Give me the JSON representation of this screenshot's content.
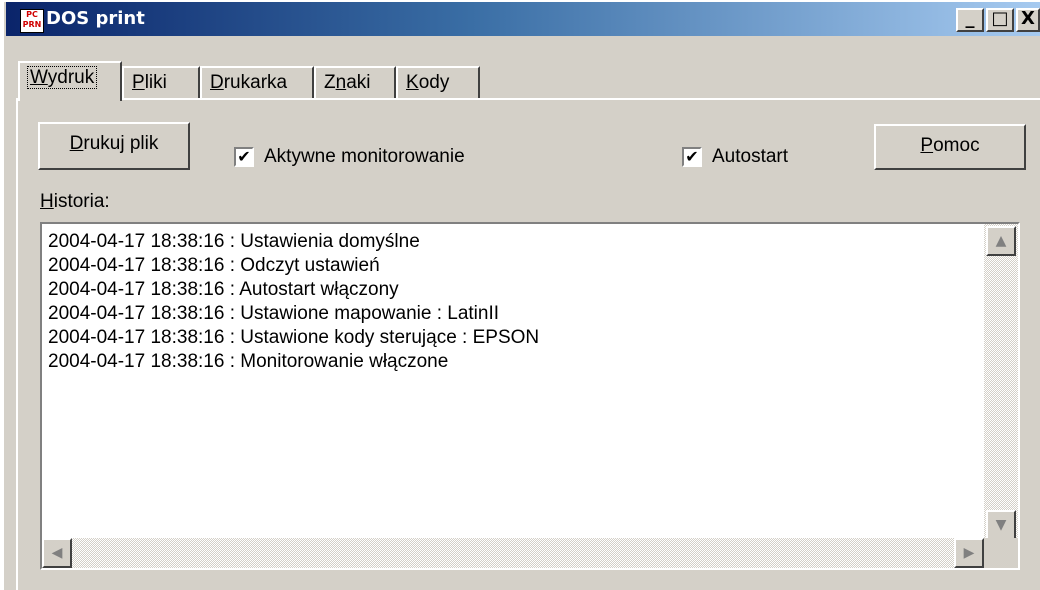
{
  "window": {
    "title": "DOS print",
    "icon_text_top": "PC",
    "icon_text_bottom": "PRN"
  },
  "caption_buttons": {
    "minimize": "_",
    "maximize": "□",
    "close": "X"
  },
  "tabs": [
    {
      "label_pre": "",
      "label_ul": "W",
      "label_post": "ydruk",
      "active": true
    },
    {
      "label_pre": "",
      "label_ul": "P",
      "label_post": "liki",
      "active": false
    },
    {
      "label_pre": "",
      "label_ul": "D",
      "label_post": "rukarka",
      "active": false
    },
    {
      "label_pre": "Z",
      "label_ul": "n",
      "label_post": "aki",
      "active": false
    },
    {
      "label_pre": "",
      "label_ul": "K",
      "label_post": "ody",
      "active": false
    }
  ],
  "toolbar": {
    "print_button": {
      "ul": "D",
      "rest": "rukuj plik"
    },
    "monitor_checkbox": {
      "label": "Aktywne monitorowanie",
      "checked": "✔"
    },
    "autostart_checkbox": {
      "label": "Autostart",
      "checked": "✔"
    },
    "help_button": {
      "ul": "P",
      "rest": "omoc"
    }
  },
  "history": {
    "label_ul": "H",
    "label_rest": "istoria:",
    "lines": [
      "2004-04-17 18:38:16 : Ustawienia domyślne",
      "2004-04-17 18:38:16 : Odczyt ustawień",
      "2004-04-17 18:38:16 : Autostart włączony",
      "2004-04-17 18:38:16 : Ustawione mapowanie : LatinII",
      "2004-04-17 18:38:16 : Ustawione kody sterujące : EPSON",
      "2004-04-17 18:38:16 : Monitorowanie włączone"
    ]
  },
  "scrollbar": {
    "up": "▲",
    "down": "▼",
    "left": "◀",
    "right": "▶"
  },
  "colors": {
    "titlebar_start": "#0a246a",
    "titlebar_end": "#a6caf0",
    "face": "#d4d0c8"
  }
}
